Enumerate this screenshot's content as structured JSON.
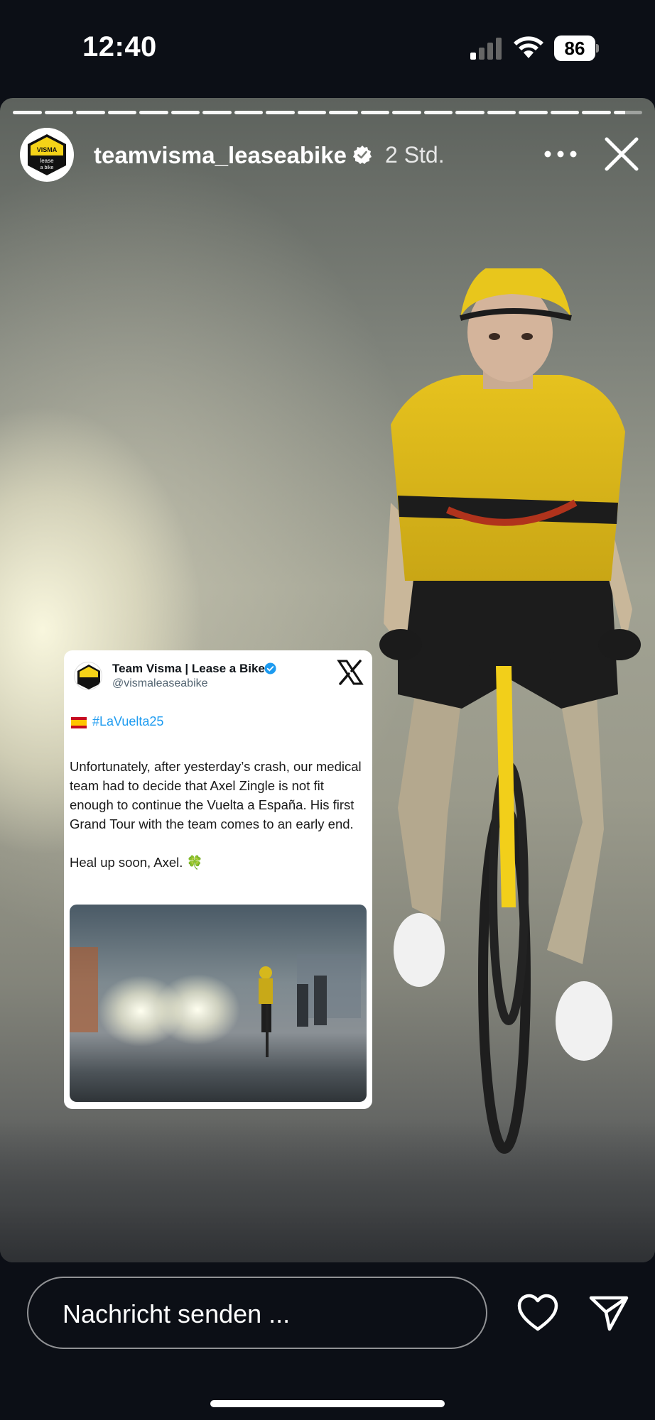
{
  "status_bar": {
    "time": "12:40",
    "battery_level": "86",
    "icons": [
      "signal-icon",
      "wifi-icon",
      "battery-icon"
    ]
  },
  "story": {
    "progress_segments": 20,
    "active_segment": 20,
    "account_name": "teamvisma_leaseabike",
    "verified": true,
    "time_ago": "2 Std.",
    "icons": [
      "more-options-icon",
      "close-icon"
    ]
  },
  "tweet": {
    "display_name": "Team Visma | Lease a Bike",
    "handle": "@vismaleaseabike",
    "hashtag": "#LaVuelta25",
    "body": "Unfortunately, after yesterday’s crash, our medical team had to decide that Axel Zingle is not fit enough to continue the Vuelta a España. His first Grand Tour with the team comes to an early end.\n\nHeal up soon, Axel.",
    "clover": "🍀",
    "brand_color": "#1d9bf0"
  },
  "avatar_logo": {
    "line1": "VISMA",
    "line2": "lease",
    "line3": "a bike"
  },
  "composer": {
    "placeholder": "Nachricht senden ...",
    "icons": [
      "heart-icon",
      "send-icon"
    ]
  },
  "colors": {
    "background": "#0c0f16",
    "team_yellow": "#f5d318"
  }
}
